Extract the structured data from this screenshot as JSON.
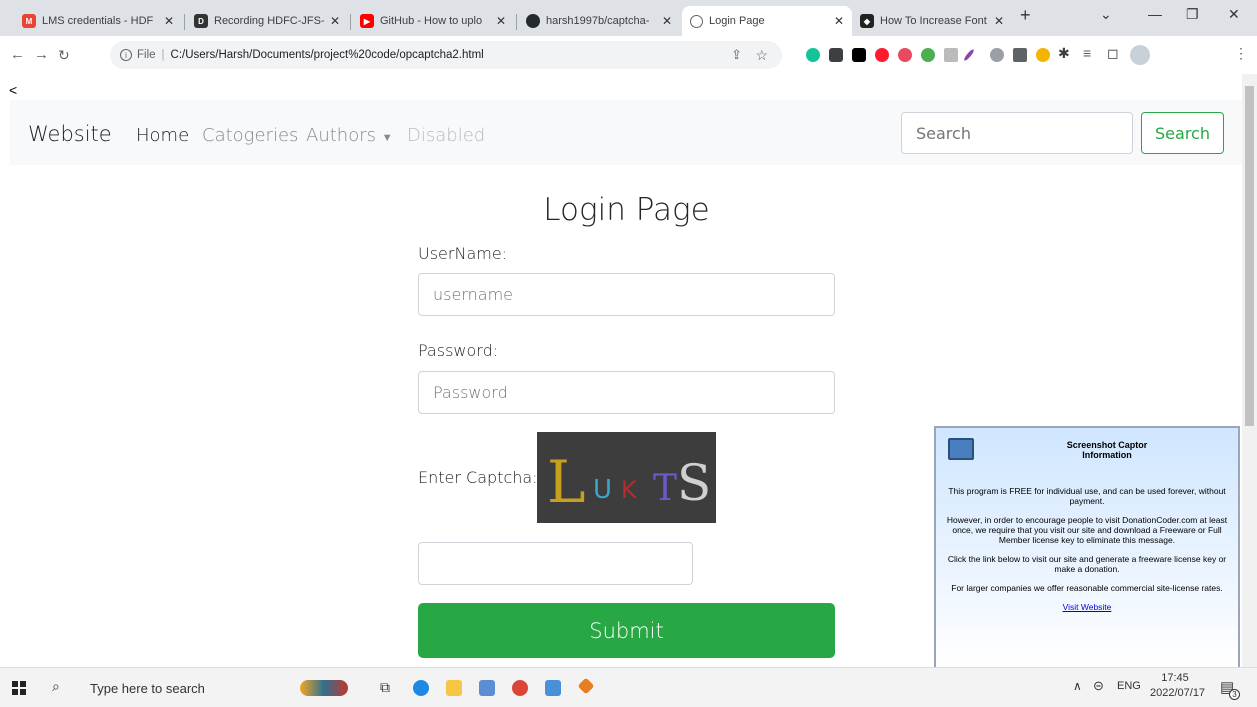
{
  "browser": {
    "tabs": [
      {
        "title": "LMS credentials - HDF",
        "icon": "gmail-icon",
        "color": "#EA4335"
      },
      {
        "title": "Recording HDFC-JFS-I",
        "icon": "recording-icon",
        "color": "#333333"
      },
      {
        "title": "GitHub - How to uplo",
        "icon": "youtube-icon",
        "color": "#FF0000"
      },
      {
        "title": "harsh1997b/captcha-",
        "icon": "github-icon",
        "color": "#24292e"
      },
      {
        "title": "Login Page",
        "icon": "globe-icon",
        "color": "#5f6368"
      },
      {
        "title": "How To Increase Font",
        "icon": "stackoverflow-icon",
        "color": "#222222"
      }
    ],
    "active_tab": 4,
    "url_prefix": "File",
    "url": "C:/Users/Harsh/Documents/project%20code/opcaptcha2.html"
  },
  "page": {
    "back_text": "<",
    "navbar": {
      "brand": "Website",
      "links": [
        "Home",
        "Catogeries",
        "Authors",
        "Disabled"
      ],
      "search_placeholder": "Search",
      "search_button": "Search"
    },
    "title": "Login Page",
    "username_label": "UserName:",
    "username_placeholder": "username",
    "password_label": "Password:",
    "password_placeholder": "Password",
    "captcha_label": "Enter Captcha:",
    "captcha_text": "LUKTS",
    "captcha_input_value": "",
    "submit_label": "Submit"
  },
  "captor": {
    "title": "Screenshot Captor",
    "subtitle": "Information",
    "para1": "This program is FREE for individual use, and can be used forever, without payment.",
    "para2": "However, in order to encourage people to visit DonationCoder.com at least once, we require that you visit our site and download a Freeware or Full Member license key to eliminate this message.",
    "para3": "Click the link below to visit our site and generate a freeware license key or make a donation.",
    "para4": "For larger companies we offer reasonable commercial site-license rates.",
    "link": "Visit Website"
  },
  "taskbar": {
    "search_placeholder": "Type here to search",
    "language": "ENG",
    "time": "17:45",
    "date": "2022/07/17",
    "notification_count": "3"
  },
  "colors": {
    "success": "#28a745",
    "navbar_bg": "#f8f9fa"
  }
}
